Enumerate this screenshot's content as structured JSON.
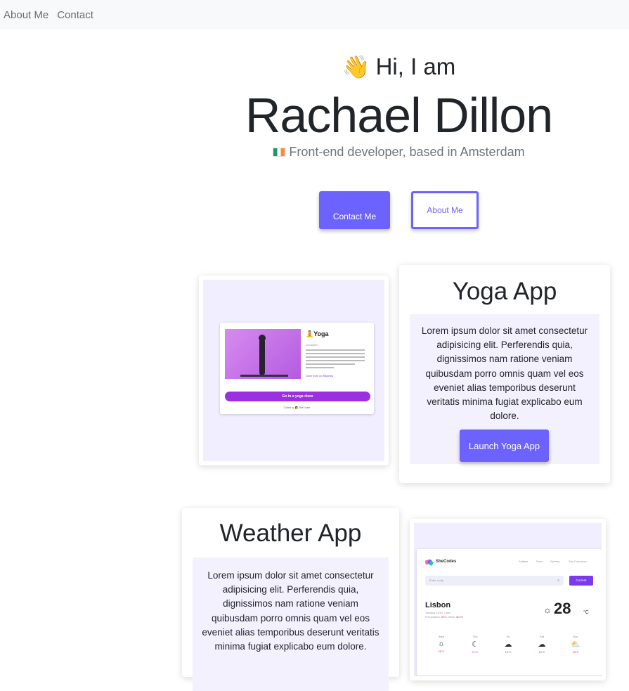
{
  "nav": {
    "items": [
      "About Me",
      "Contact"
    ]
  },
  "hero": {
    "greeting": "Hi, I am",
    "name": "Rachael Dillon",
    "subtitle": "Front-end developer, based in Amsterdam",
    "contact_button": "Contact Me",
    "about_button": "About Me"
  },
  "projects": [
    {
      "title": "Yoga App",
      "description": "Lorem ipsum dolor sit amet consectetur adipisicing elit. Perferendis quia, dignissimos nam ratione veniam quibusdam porro omnis quam vel eos eveniet alias temporibus deserunt veritatis minima fugiat explicabo eum dolore.",
      "button": "Launch Yoga App",
      "preview": {
        "title": "🧘Yoga",
        "category": "Discipline",
        "link": "Learn more on Wikipedia",
        "cta": "Go to a yoga class",
        "credit": "Coded by 👩 SheCodes"
      }
    },
    {
      "title": "Weather App",
      "description": "Lorem ipsum dolor sit amet consectetur adipisicing elit. Perferendis quia, dignissimos nam ratione veniam quibusdam porro omnis quam vel eos eveniet alias temporibus deserunt veritatis minima fugiat explicabo eum dolore.",
      "preview": {
        "brand": "SheCodes",
        "cities": [
          "Lisbon",
          "Paris",
          "Sydney",
          "San Francisco"
        ],
        "search_placeholder": "Enter a city",
        "current_button": "Current",
        "city": "Lisbon",
        "date": "Tuesday 16:00, Clear",
        "precipitation_label": "Precipitation:",
        "precipitation_value": "60%",
        "wind_label": "Wind:",
        "wind_value": "3km/h",
        "temperature": "28",
        "unit": "°C",
        "forecast": [
          {
            "day": "Wed",
            "icon": "sun-icon",
            "glyph": "☼",
            "temp": "28°C"
          },
          {
            "day": "Thu",
            "icon": "moon-icon",
            "glyph": "☾",
            "temp": "21°C"
          },
          {
            "day": "Fri",
            "icon": "cloud-icon",
            "glyph": "☁",
            "temp": "16°C"
          },
          {
            "day": "Sat",
            "icon": "cloud-icon",
            "glyph": "☁",
            "temp": "16°C"
          },
          {
            "day": "Sun",
            "icon": "partly-cloudy-icon",
            "glyph": "⛅",
            "temp": "16°C"
          }
        ]
      }
    }
  ],
  "colors": {
    "accent": "#6c63ff",
    "nav_bg": "#f8f9fa",
    "desc_bg": "#f4f1ff"
  }
}
